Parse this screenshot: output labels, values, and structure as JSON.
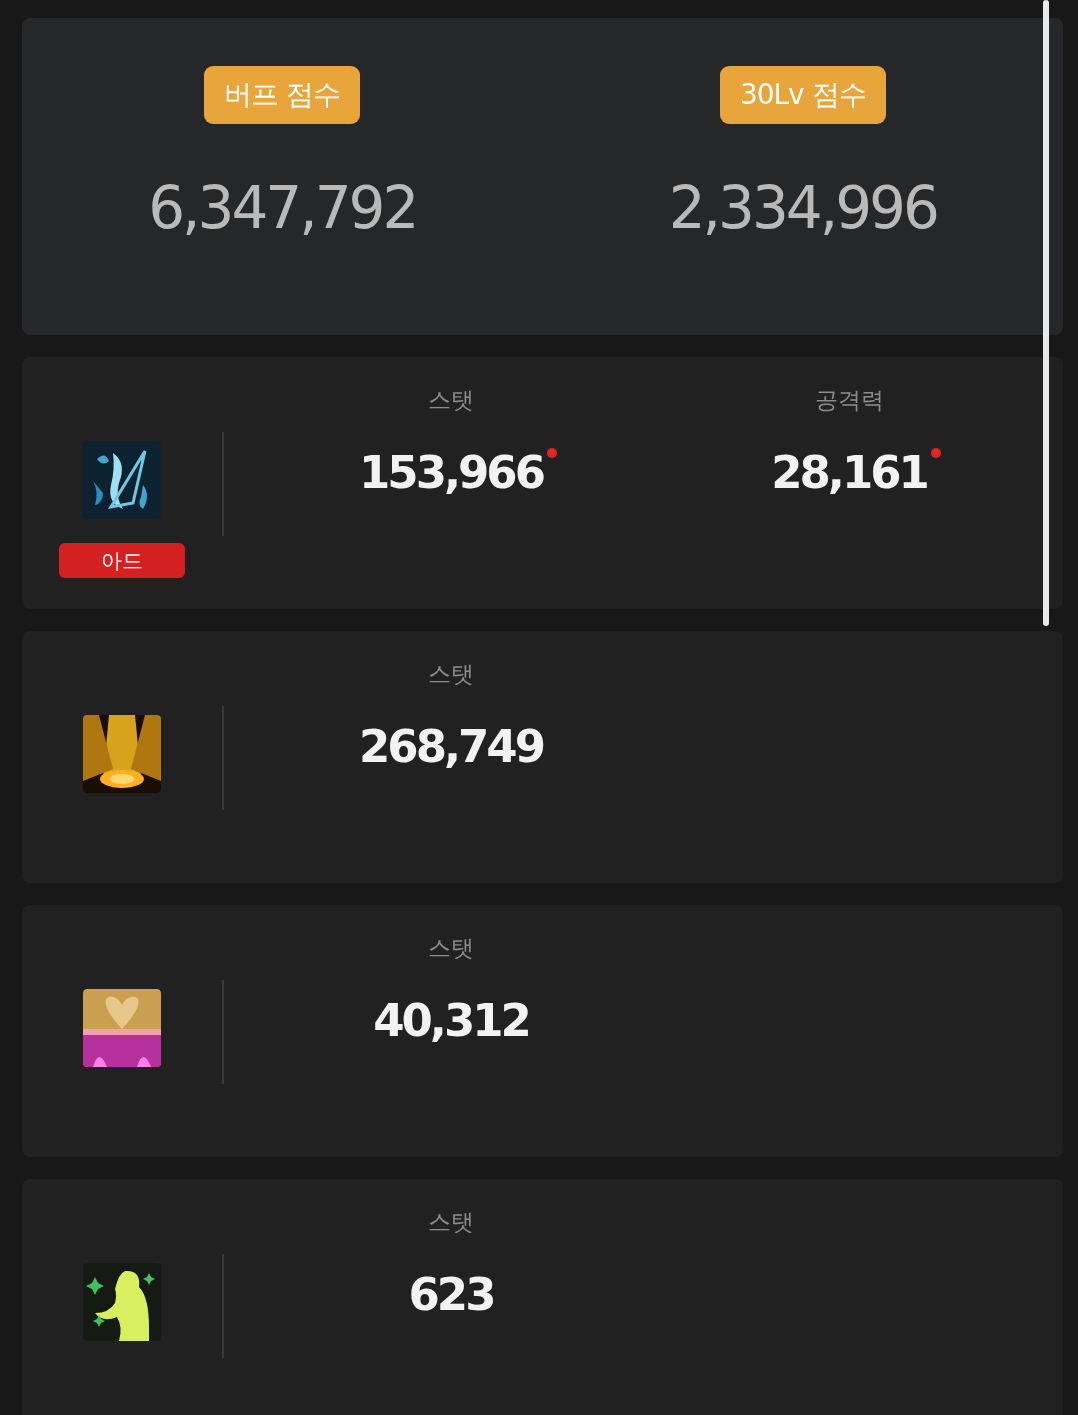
{
  "scores": [
    {
      "label": "버프 점수",
      "value": "6,347,792"
    },
    {
      "label": "30Lv 점수",
      "value": "2,334,996"
    }
  ],
  "skills": [
    {
      "kind": "harp",
      "tag": "아드",
      "stats": [
        {
          "label": "스탯",
          "value": "153,966",
          "changed": true
        },
        {
          "label": "공격력",
          "value": "28,161",
          "changed": true
        }
      ]
    },
    {
      "kind": "spotlight",
      "stats": [
        {
          "label": "스탯",
          "value": "268,749",
          "changed": false
        }
      ]
    },
    {
      "kind": "heart",
      "stats": [
        {
          "label": "스탯",
          "value": "40,312",
          "changed": false
        }
      ]
    },
    {
      "kind": "figure",
      "stats": [
        {
          "label": "스탯",
          "value": "623",
          "changed": false
        }
      ]
    }
  ]
}
